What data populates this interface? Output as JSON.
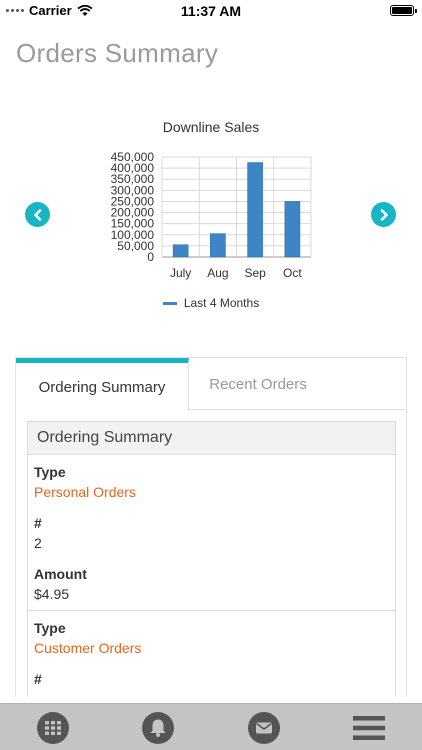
{
  "status_bar": {
    "carrier": "Carrier",
    "time": "11:37 AM"
  },
  "page_title": "Orders Summary",
  "chart_data": {
    "type": "bar",
    "title": "Downline Sales",
    "categories": [
      "July",
      "Aug",
      "Sep",
      "Oct"
    ],
    "series": [
      {
        "name": "Last 4 Months",
        "values": [
          55000,
          105000,
          425000,
          250000
        ]
      }
    ],
    "ylim": [
      0,
      450000
    ],
    "yticks": [
      "0",
      "50,000",
      "100,000",
      "150,000",
      "200,000",
      "250,000",
      "300,000",
      "350,000",
      "400,000",
      "450,000"
    ],
    "grid": true,
    "legend_position": "bottom",
    "bar_color": "#3d85c6"
  },
  "nav": {
    "prev_icon": "chevron-left-icon",
    "next_icon": "chevron-right-icon",
    "accent": "#1ab5c4"
  },
  "tabs": [
    {
      "label": "Ordering Summary",
      "active": true
    },
    {
      "label": "Recent Orders",
      "active": false
    }
  ],
  "summary": {
    "header": "Ordering Summary",
    "labels": {
      "type": "Type",
      "count": "#",
      "amount": "Amount"
    },
    "orders": [
      {
        "type": "Personal Orders",
        "count": "2",
        "amount": "$4.95"
      },
      {
        "type": "Customer Orders"
      }
    ]
  },
  "colors": {
    "orange_value": "#e2651d",
    "bottom_bar": "#c4c4c4",
    "icon": "#555555"
  },
  "bottom_nav": [
    "grid-icon",
    "bell-icon",
    "mail-icon",
    "menu-icon"
  ]
}
